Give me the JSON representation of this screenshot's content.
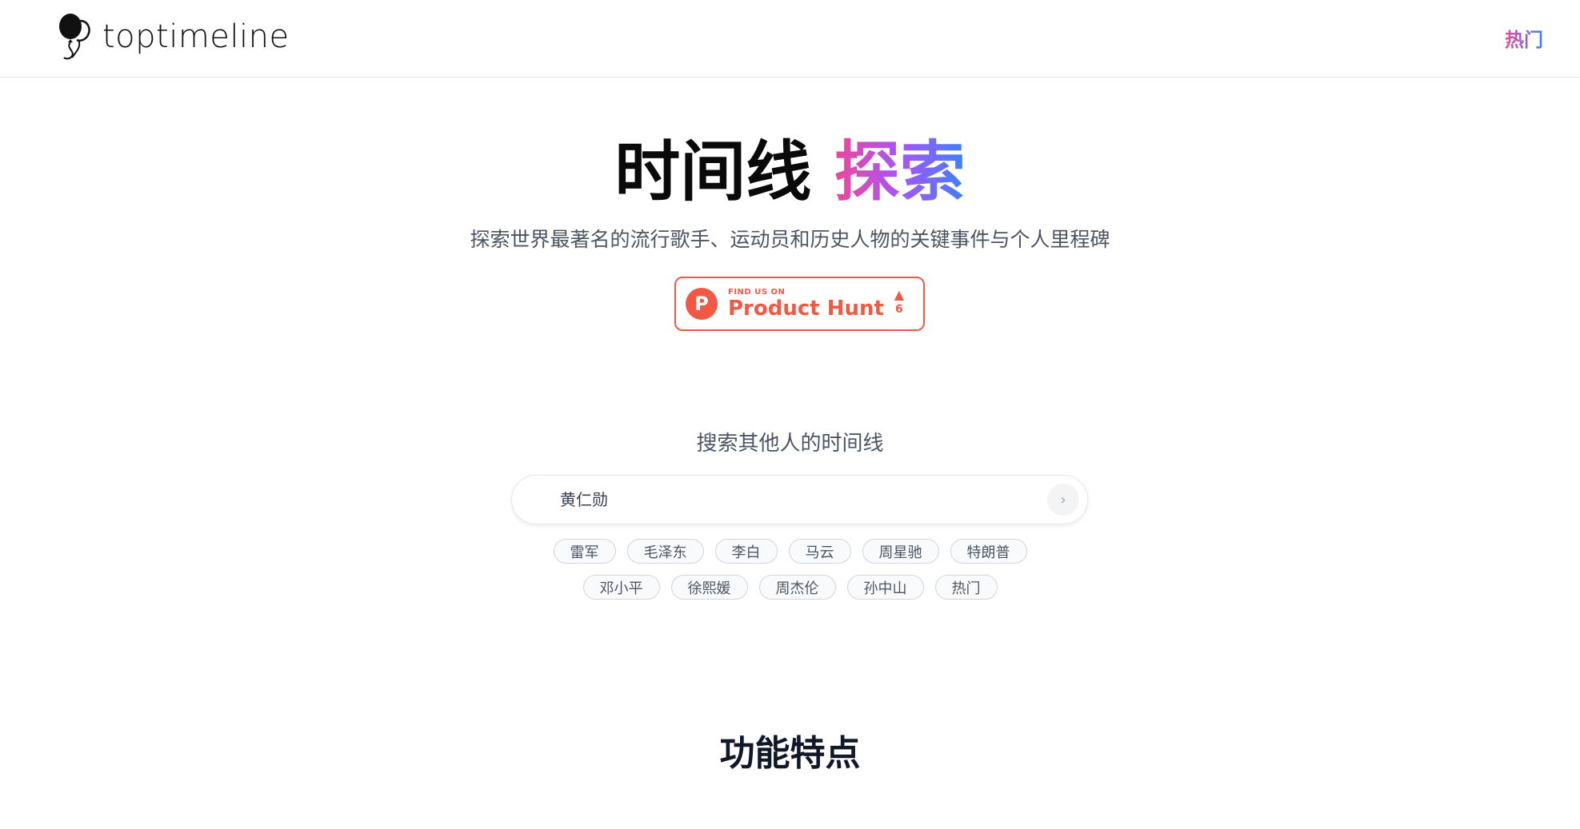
{
  "header": {
    "logo_text": "toptimeline",
    "nav_hot": "热门"
  },
  "hero": {
    "title_main": "时间线 ",
    "title_accent": "探索",
    "subtitle": "探索世界最著名的流行歌手、运动员和历史人物的关键事件与个人里程碑"
  },
  "product_hunt": {
    "small_text": "FIND US ON",
    "big_text": "Product Hunt",
    "logo_letter": "P",
    "upvote_count": "6",
    "color": "#f05a44"
  },
  "search": {
    "label": "搜索其他人的时间线",
    "placeholder": "黄仁勋",
    "submit_icon": "chevron-right-icon"
  },
  "tags_row1": [
    "雷军",
    "毛泽东",
    "李白",
    "马云",
    "周星驰",
    "特朗普"
  ],
  "tags_row2": [
    "邓小平",
    "徐熙媛",
    "周杰伦",
    "孙中山",
    "热门"
  ],
  "features": {
    "title": "功能特点"
  }
}
